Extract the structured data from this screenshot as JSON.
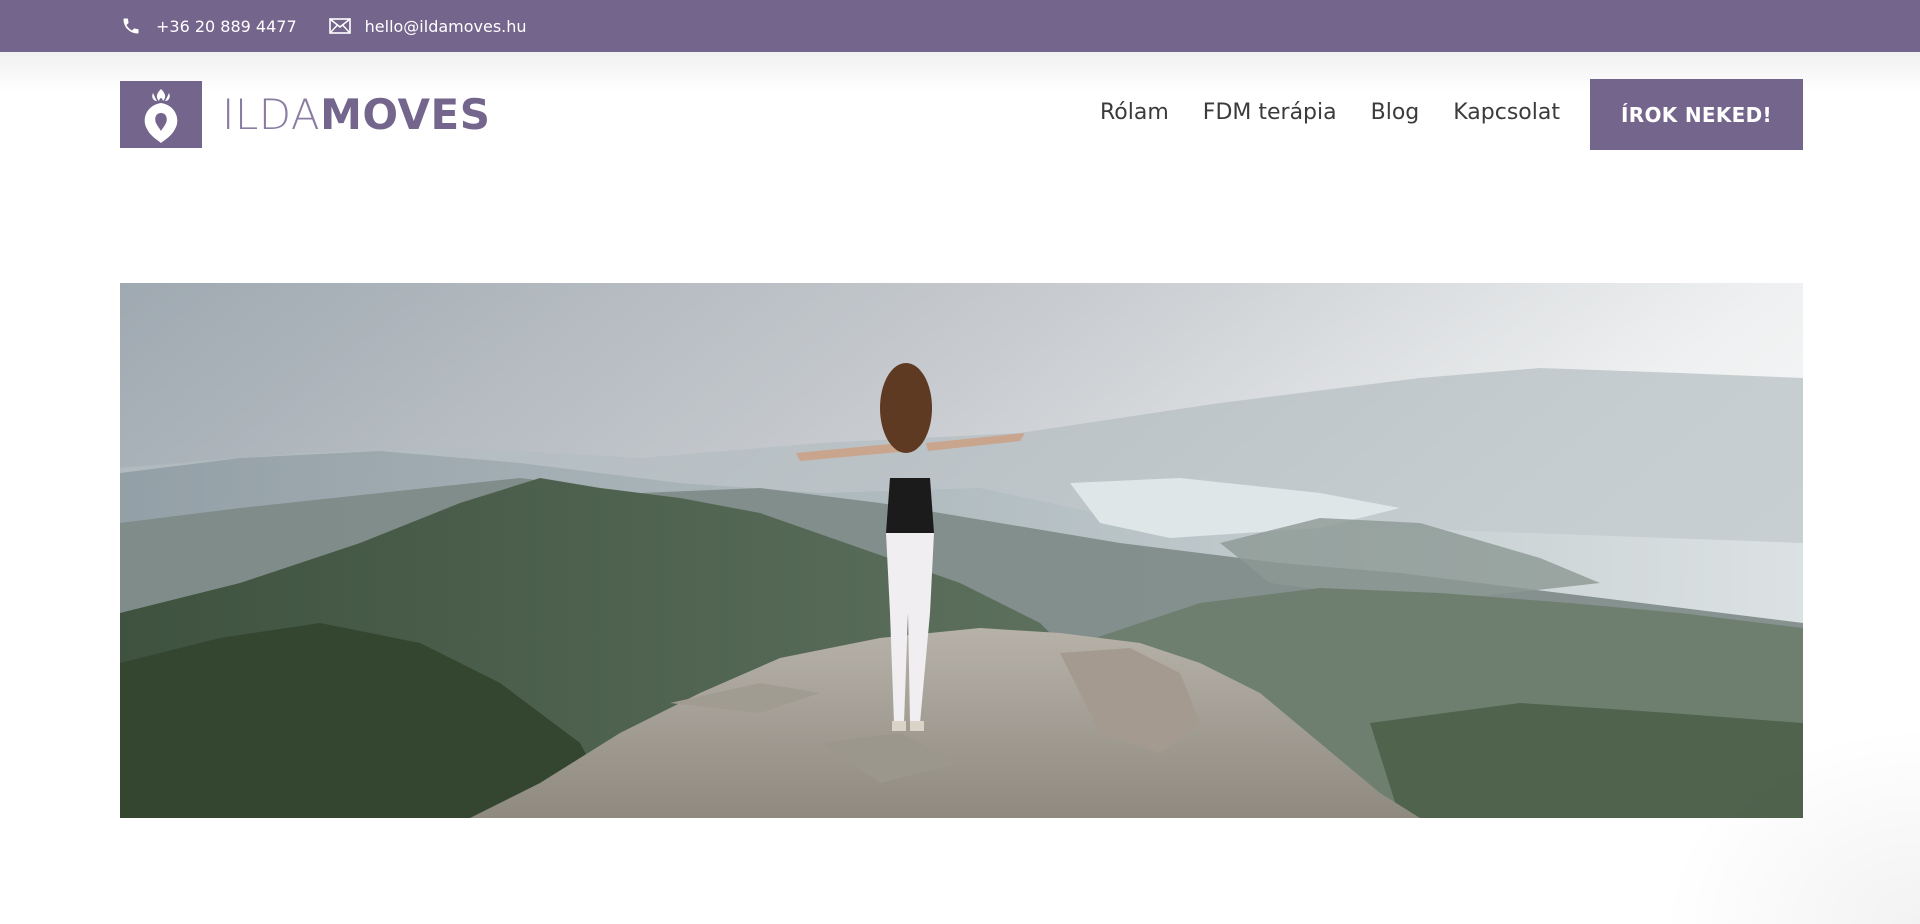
{
  "topbar": {
    "phone": "+36 20 889 4477",
    "email": "hello@ildamoves.hu",
    "phone_icon": "phone-icon",
    "email_icon": "mail-icon"
  },
  "logo": {
    "light_part": "ILDA",
    "bold_part": "MOVES"
  },
  "nav": {
    "items": [
      {
        "label": "Rólam"
      },
      {
        "label": "FDM terápia"
      },
      {
        "label": "Blog"
      },
      {
        "label": "Kapcsolat"
      }
    ]
  },
  "cta": {
    "label": "ÍROK NEKED!"
  },
  "hero": {
    "image_description_icon": "landscape-photo"
  },
  "colors": {
    "brand": "#74658c",
    "text": "#3b3b3b",
    "background": "#ffffff"
  }
}
